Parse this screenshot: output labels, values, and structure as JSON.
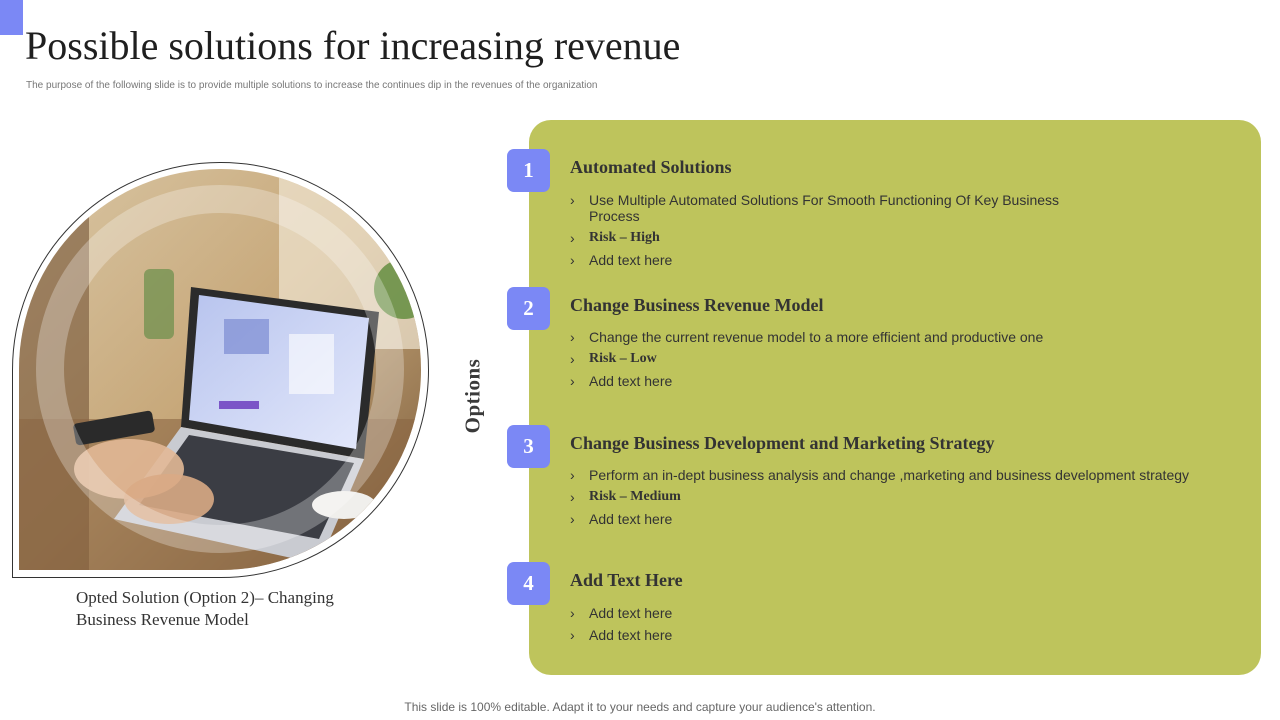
{
  "slide": {
    "title": "Possible solutions for increasing revenue",
    "subtitle": "The purpose of the  following slide is to provide multiple  solutions to increase the continues dip  in the revenues of the organization",
    "caption_line1": "Opted Solution (Option 2)– Changing",
    "caption_line2": "Business Revenue Model",
    "options_label": "Options",
    "footer": "This slide is 100% editable. Adapt it to your needs and capture your audience's attention.",
    "bullet_glyph": "›"
  },
  "options": [
    {
      "number": "1",
      "title": "Automated Solutions",
      "bullets": [
        "Use Multiple Automated Solutions For Smooth Functioning Of Key Business Process",
        "Risk – High",
        "Add text here"
      ]
    },
    {
      "number": "2",
      "title": "Change Business Revenue Model",
      "bullets": [
        "Change the current revenue  model to a more efficient and productive one",
        "Risk – Low",
        "Add text here"
      ]
    },
    {
      "number": "3",
      "title": "Change Business Development and Marketing Strategy",
      "bullets": [
        "Perform an in-dept business analysis and change ,marketing and business development strategy",
        "Risk – Medium",
        "Add text here"
      ]
    },
    {
      "number": "4",
      "title": "Add Text Here",
      "bullets": [
        "Add text here",
        "Add text here"
      ]
    }
  ],
  "colors": {
    "accent": "#7b88f5",
    "panel": "#bec45c"
  },
  "image": {
    "icon": "laptop-photo"
  }
}
